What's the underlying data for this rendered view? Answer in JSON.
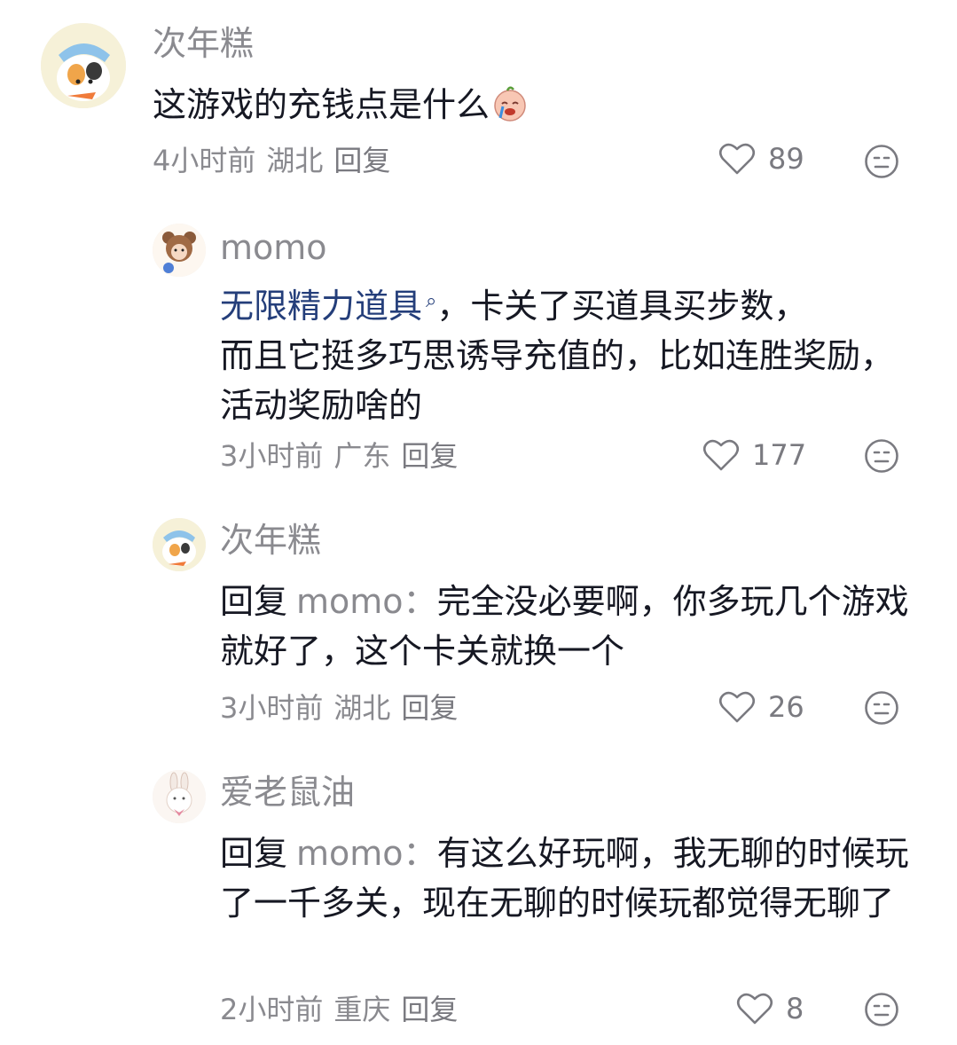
{
  "comments": [
    {
      "username": "次年糕",
      "text": "这游戏的充钱点是什么",
      "time": "4小时前",
      "location": "湖北",
      "reply_label": "回复",
      "likes": "89"
    },
    {
      "username": "momo",
      "link_text": "无限精力道具",
      "text_line1_rest": "，卡关了买道具买步数，",
      "text_rest": "而且它挺多巧思诱导充值的，比如连胜奖励，活动奖励啥的",
      "time": "3小时前",
      "location": "广东",
      "reply_label": "回复",
      "likes": "177"
    },
    {
      "username": "次年糕",
      "reply_prefix": "回复",
      "mention": "momo：",
      "text": "完全没必要啊，你多玩几个游戏就好了，这个卡关就换一个",
      "time": "3小时前",
      "location": "湖北",
      "reply_label": "回复",
      "likes": "26"
    },
    {
      "username": "爱老鼠油",
      "reply_prefix": "回复",
      "mention": "momo：",
      "text": "有这么好玩啊，我无聊的时候玩了一千多关，现在无聊的时候玩都觉得无聊了",
      "time": "2小时前",
      "location": "重庆",
      "reply_label": "回复",
      "likes": "8"
    }
  ],
  "icons": {
    "like": "heart-outline-icon",
    "dislike": "neutral-face-icon",
    "search": "search-icon",
    "emoji": "crying-emoji-icon"
  },
  "colors": {
    "text": "#161823",
    "secondary": "#8a8a8f",
    "link": "#243e7a"
  }
}
